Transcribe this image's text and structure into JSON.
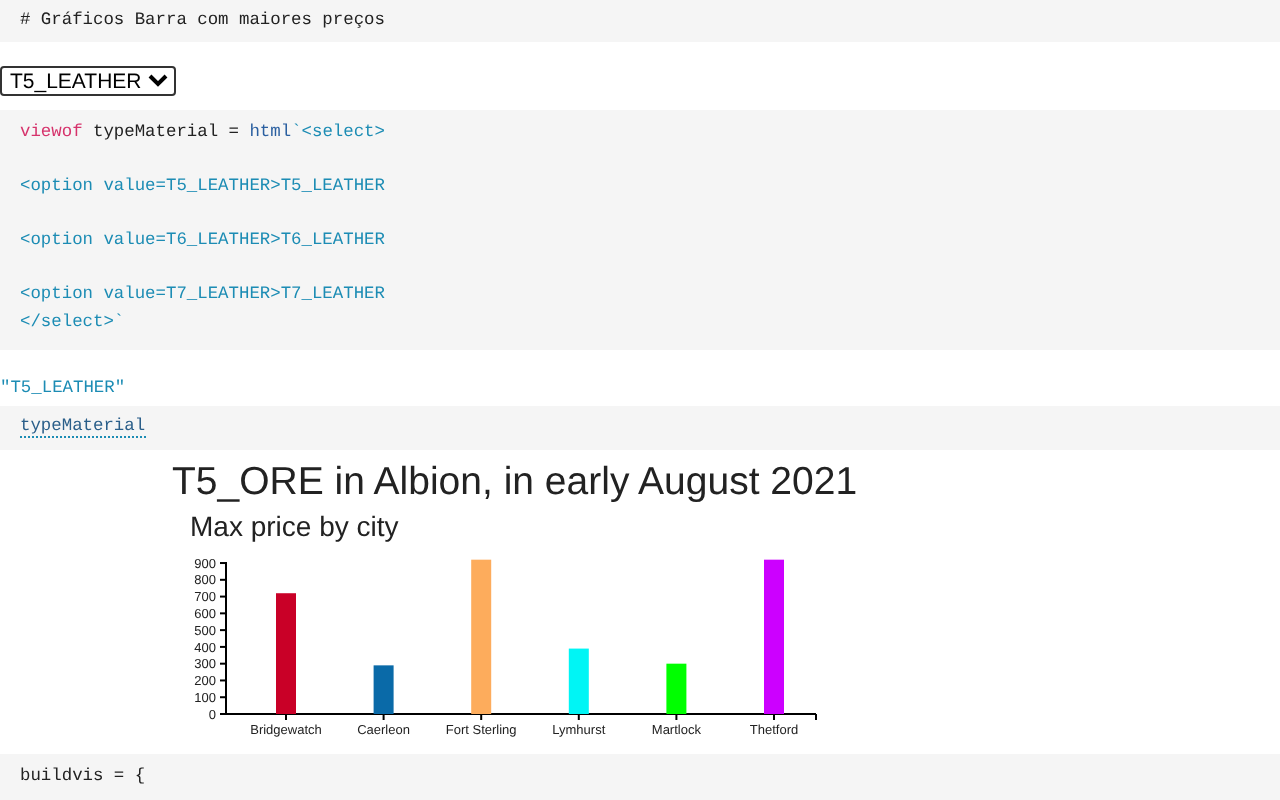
{
  "markdown_cell": {
    "source": "# Gráficos Barra com maiores preços"
  },
  "select": {
    "value": "T5_LEATHER"
  },
  "code_cell": {
    "lines": [
      {
        "blank_after": true,
        "segments": [
          {
            "kind": "keyword",
            "text": "viewof"
          },
          {
            "kind": "plain",
            "text": " typeMaterial = "
          },
          {
            "kind": "builtin",
            "text": "html"
          },
          {
            "kind": "string",
            "text": "`<select>"
          }
        ]
      },
      {
        "blank_after": true,
        "segments": [
          {
            "kind": "string",
            "text": "<option value=T5_LEATHER>T5_LEATHER"
          }
        ]
      },
      {
        "blank_after": true,
        "segments": [
          {
            "kind": "string",
            "text": "<option value=T6_LEATHER>T6_LEATHER"
          }
        ]
      },
      {
        "blank_after": false,
        "segments": [
          {
            "kind": "string",
            "text": "<option value=T7_LEATHER>T7_LEATHER"
          }
        ]
      },
      {
        "blank_after": false,
        "segments": [
          {
            "kind": "string",
            "text": "</select>`"
          }
        ]
      }
    ]
  },
  "value_output": "\"T5_LEATHER\"",
  "reference_cell": {
    "source": "typeMaterial"
  },
  "figure": {
    "title": "T5_ORE in Albion, in early August 2021",
    "subtitle": "Max price by city",
    "chart_data": {
      "type": "bar",
      "categories": [
        "Bridgewatch",
        "Caerleon",
        "Fort Sterling",
        "Lymhurst",
        "Martlock",
        "Thetford"
      ],
      "values": [
        720,
        290,
        920,
        390,
        300,
        920
      ],
      "colors": [
        "#c90027",
        "#0a6aa8",
        "#fdac5c",
        "#00f5f5",
        "#00ff00",
        "#cc00ff"
      ],
      "ylim": [
        0,
        930
      ],
      "yticks": [
        0,
        100,
        200,
        300,
        400,
        500,
        600,
        700,
        800,
        900
      ]
    }
  },
  "code_cell_2": {
    "source": "buildvis = {"
  }
}
